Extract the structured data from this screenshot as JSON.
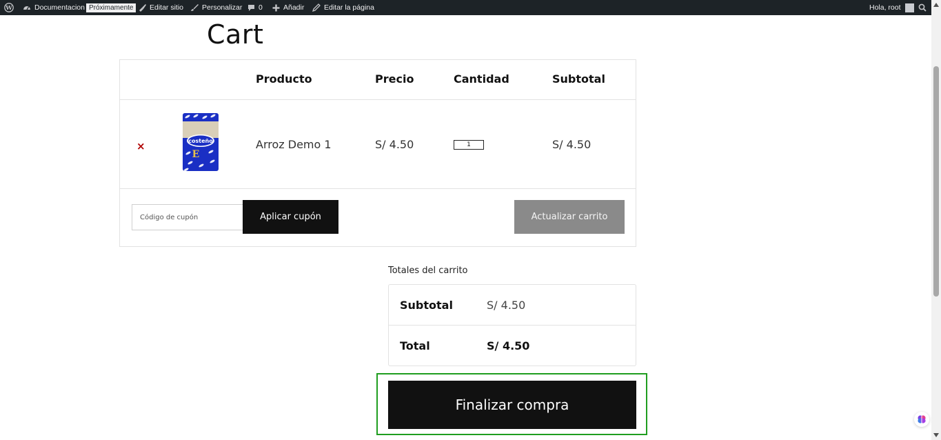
{
  "admin_bar": {
    "site_name": "Documentacion",
    "badge": "Próximamente",
    "edit_site": "Editar sitio",
    "customize": "Personalizar",
    "comments_count": "0",
    "add_new": "Añadir",
    "edit_page": "Editar la página",
    "greeting": "Hola, root"
  },
  "page": {
    "title": "Cart"
  },
  "cart_table": {
    "headers": {
      "product": "Producto",
      "price": "Precio",
      "quantity": "Cantidad",
      "subtotal": "Subtotal"
    },
    "items": [
      {
        "name": "Arroz Demo 1",
        "price": "S/ 4.50",
        "quantity": "1",
        "subtotal": "S/ 4.50",
        "image_brand": "costeño"
      }
    ],
    "remove_symbol": "×"
  },
  "actions": {
    "coupon_placeholder": "Código de cupón",
    "apply_coupon": "Aplicar cupón",
    "update_cart": "Actualizar carrito"
  },
  "totals": {
    "heading": "Totales del carrito",
    "subtotal_label": "Subtotal",
    "subtotal_value": "S/ 4.50",
    "total_label": "Total",
    "total_value": "S/ 4.50"
  },
  "checkout": {
    "button_label": "Finalizar compra"
  },
  "colors": {
    "admin_bar": "#1d2327",
    "remove": "#b00000",
    "primary_button": "#111111",
    "update_button": "#8a8a8a",
    "highlight_border": "#1f9d1f",
    "product_bag": "#1a2fc4"
  }
}
